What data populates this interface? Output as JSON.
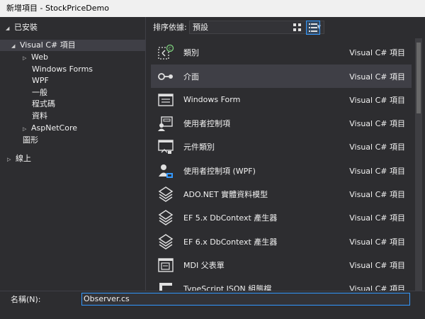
{
  "window": {
    "title": "新增項目 - StockPriceDemo"
  },
  "tree": {
    "installed": "已安裝",
    "visual_csharp": "Visual C# 項目",
    "web": "Web",
    "windows_forms": "Windows Forms",
    "wpf": "WPF",
    "general": "一般",
    "code": "程式碼",
    "data": "資料",
    "aspnetcore": "AspNetCore",
    "graphics": "圖形",
    "online": "線上"
  },
  "sort": {
    "label": "排序依據:",
    "selected": "預設"
  },
  "items": [
    {
      "name": "類別",
      "lang": "Visual C# 項目",
      "icon": "class-icon"
    },
    {
      "name": "介面",
      "lang": "Visual C# 項目",
      "icon": "interface-icon"
    },
    {
      "name": "Windows Form",
      "lang": "Visual C# 項目",
      "icon": "windows-form-icon"
    },
    {
      "name": "使用者控制項",
      "lang": "Visual C# 項目",
      "icon": "user-control-icon"
    },
    {
      "name": "元件類別",
      "lang": "Visual C# 項目",
      "icon": "component-class-icon"
    },
    {
      "name": "使用者控制項 (WPF)",
      "lang": "Visual C# 項目",
      "icon": "user-control-wpf-icon"
    },
    {
      "name": "ADO.NET 實體資料模型",
      "lang": "Visual C# 項目",
      "icon": "entity-model-icon"
    },
    {
      "name": "EF 5.x DbContext 產生器",
      "lang": "Visual C# 項目",
      "icon": "dbcontext-generator-icon"
    },
    {
      "name": "EF 6.x DbContext 產生器",
      "lang": "Visual C# 項目",
      "icon": "dbcontext-generator-icon"
    },
    {
      "name": "MDI 父表單",
      "lang": "Visual C# 項目",
      "icon": "mdi-parent-form-icon"
    },
    {
      "name": "TypeScript JSON 組態檔",
      "lang": "Visual C# 項目",
      "icon": "json-config-icon"
    }
  ],
  "name_field": {
    "label": "名稱(N):",
    "value": "Observer.cs"
  },
  "colors": {
    "accent": "#3399ff",
    "background": "#2d2d30",
    "selection": "#3f3f46"
  }
}
